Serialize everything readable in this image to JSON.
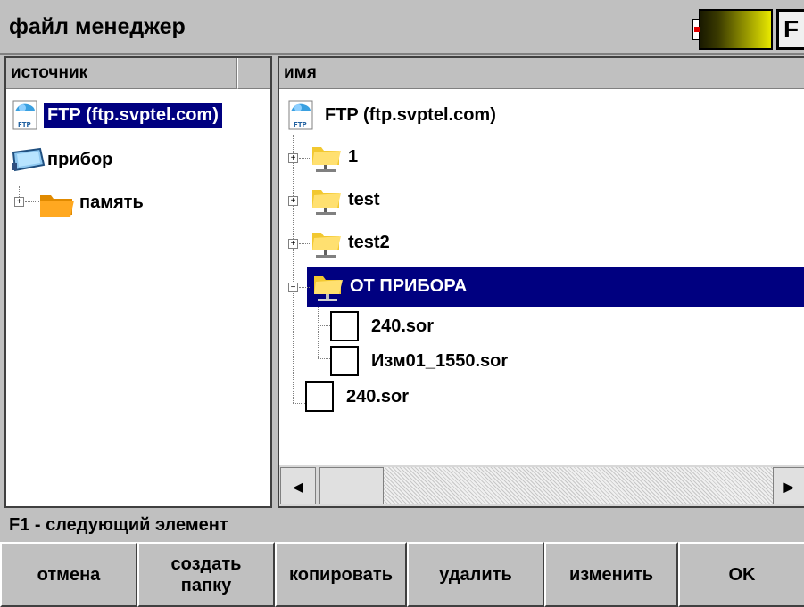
{
  "window": {
    "title": "файл менеджер",
    "f_key": "F"
  },
  "left": {
    "header": "источник",
    "items": [
      {
        "label": "FTP (ftp.svptel.com)",
        "icon": "ftp-icon",
        "selected": true
      },
      {
        "label": "прибор",
        "icon": "device-icon"
      },
      {
        "label": "память",
        "icon": "folder-icon",
        "expander": "+"
      }
    ]
  },
  "right": {
    "header": "имя",
    "root": {
      "label": "FTP (ftp.svptel.com)",
      "icon": "ftp-icon"
    },
    "items": [
      {
        "label": "1",
        "type": "folder",
        "expander": "+"
      },
      {
        "label": "test",
        "type": "folder",
        "expander": "+"
      },
      {
        "label": "test2",
        "type": "folder",
        "expander": "+"
      },
      {
        "label": "ОТ ПРИБОРА",
        "type": "folder",
        "expander": "−",
        "selected": true
      },
      {
        "label": "240.sor",
        "type": "file"
      },
      {
        "label": "Изм01_1550.sor",
        "type": "file"
      },
      {
        "label": "240.sor",
        "type": "file"
      }
    ]
  },
  "status": "F1 - следующий элемент",
  "buttons": {
    "cancel": "отмена",
    "create_folder_1": "создать",
    "create_folder_2": "папку",
    "copy": "копировать",
    "delete": "удалить",
    "rename": "изменить",
    "ok": "OK"
  },
  "colors": {
    "selection": "#000080",
    "background": "#c0c0c0",
    "battery": "#e8e800",
    "battery_alert": "#e00000"
  }
}
